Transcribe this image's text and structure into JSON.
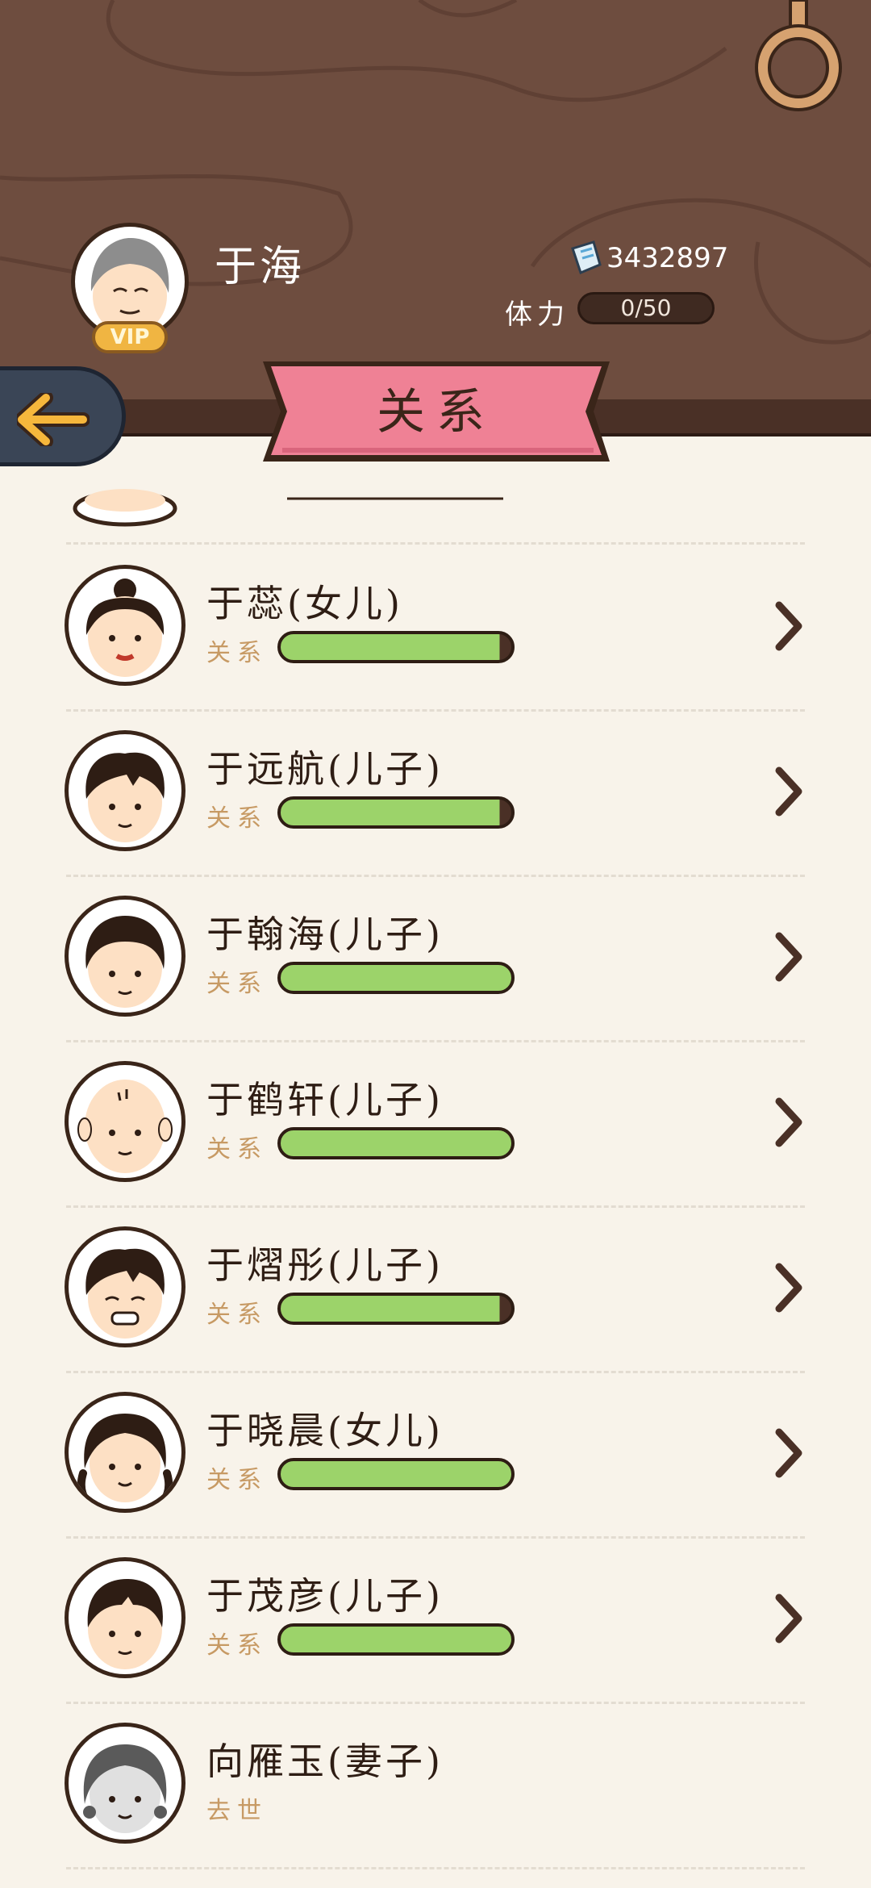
{
  "player": {
    "name": "于海",
    "vip": "VIP",
    "coins": "3432897",
    "stamina_label": "体力",
    "stamina": "0/50"
  },
  "page_title": "关系",
  "relations": [
    {
      "name": "于蕊(女儿)",
      "status": "关系",
      "relationship_level": 0.95,
      "avatar": "daughter-bun-icon"
    },
    {
      "name": "于远航(儿子)",
      "status": "关系",
      "relationship_level": 0.95,
      "avatar": "son-tuft-icon"
    },
    {
      "name": "于翰海(儿子)",
      "status": "关系",
      "relationship_level": 1.0,
      "avatar": "son-bowl-icon"
    },
    {
      "name": "于鹤轩(儿子)",
      "status": "关系",
      "relationship_level": 1.0,
      "avatar": "baby-bald-icon"
    },
    {
      "name": "于熠彤(儿子)",
      "status": "关系",
      "relationship_level": 0.95,
      "avatar": "son-grin-icon"
    },
    {
      "name": "于晓晨(女儿)",
      "status": "关系",
      "relationship_level": 1.0,
      "avatar": "daughter-braids-icon"
    },
    {
      "name": "于茂彦(儿子)",
      "status": "关系",
      "relationship_level": 1.0,
      "avatar": "son-short-icon"
    },
    {
      "name": "向雁玉(妻子)",
      "status": "去世",
      "avatar": "wife-gray-icon"
    }
  ],
  "colors": {
    "header": "#6e4d3f",
    "banner": "#ef8195",
    "bar": "#9cd36a",
    "background": "#f8f3ea"
  }
}
